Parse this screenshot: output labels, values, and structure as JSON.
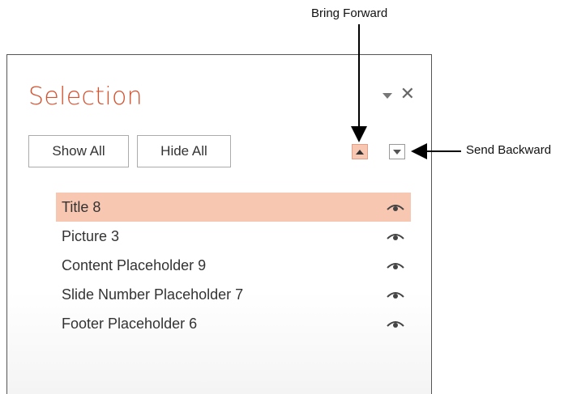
{
  "callouts": {
    "bring_forward": "Bring Forward",
    "send_backward": "Send Backward"
  },
  "pane": {
    "title": "Selection",
    "show_all_label": "Show All",
    "hide_all_label": "Hide All",
    "close_glyph": "✕"
  },
  "items": [
    {
      "label": "Title 8",
      "selected": true,
      "visible": true
    },
    {
      "label": "Picture 3",
      "selected": false,
      "visible": true
    },
    {
      "label": "Content Placeholder 9",
      "selected": false,
      "visible": true
    },
    {
      "label": "Slide Number Placeholder 7",
      "selected": false,
      "visible": true
    },
    {
      "label": "Footer Placeholder 6",
      "selected": false,
      "visible": true
    }
  ],
  "colors": {
    "title_accent": "#d35230",
    "selected_row": "#f8c7b2"
  },
  "icons": {
    "visibility": "eye-icon",
    "bring_forward": "triangle-up-icon",
    "send_backward": "triangle-down-icon",
    "options": "dropdown-triangle-icon",
    "close": "close-icon"
  }
}
